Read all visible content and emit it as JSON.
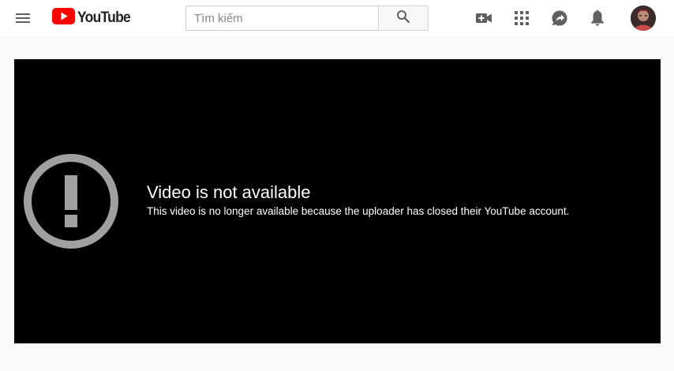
{
  "header": {
    "logo_text": "YouTube",
    "search": {
      "placeholder": "Tìm kiếm",
      "value": ""
    },
    "icons": [
      "menu-icon",
      "youtube-logo-icon",
      "search-icon",
      "create-video-icon",
      "apps-grid-icon",
      "messages-icon",
      "notifications-bell-icon",
      "avatar"
    ]
  },
  "player": {
    "error_title": "Video is not available",
    "error_reason": "This video is no longer available because the uploader has closed their YouTube account."
  },
  "colors": {
    "brand_red": "#ff0000",
    "header_bg": "#ffffff",
    "page_bg": "#f9f9f9",
    "player_bg": "#000000",
    "icon_gray": "#606060",
    "error_icon_gray": "#a0a0a0"
  }
}
